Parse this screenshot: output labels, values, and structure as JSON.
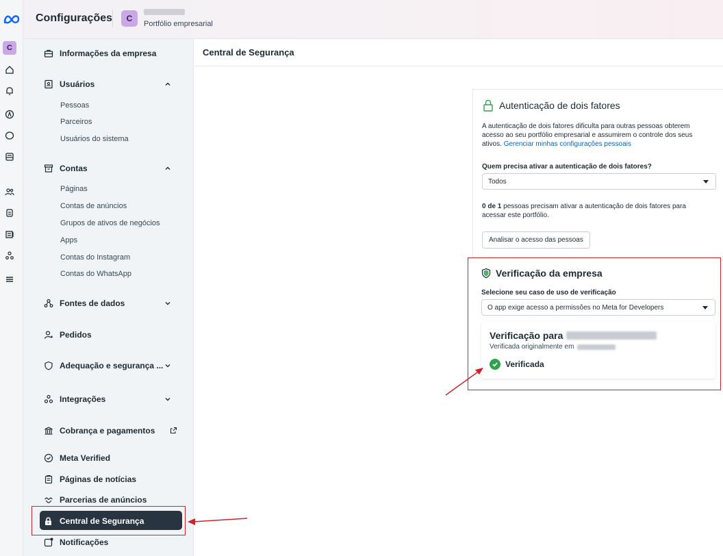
{
  "header": {
    "title": "Configurações",
    "business_avatar": "C",
    "business_subtitle": "Portfólio empresarial"
  },
  "rail": {
    "avatar": "C",
    "icons": [
      "meta-logo-icon",
      "home-icon",
      "bell-icon",
      "ads-icon",
      "chat-icon",
      "inbox-icon",
      "people-icon",
      "assets-icon",
      "tools-icon",
      "data-icon",
      "menu-icon"
    ]
  },
  "sidebar": {
    "company_info": "Informações da empresa",
    "users": {
      "label": "Usuários",
      "items": [
        "Pessoas",
        "Parceiros",
        "Usuários do sistema"
      ]
    },
    "accounts": {
      "label": "Contas",
      "items": [
        "Páginas",
        "Contas de anúncios",
        "Grupos de ativos de negócios",
        "Apps",
        "Contas do Instagram",
        "Contas do WhatsApp"
      ]
    },
    "data_sources": "Fontes de dados",
    "requests": "Pedidos",
    "compliance": "Adequação e segurança ...",
    "integrations": "Integrações",
    "billing": "Cobrança e pagamentos",
    "meta_verified": "Meta Verified",
    "news_pages": "Páginas de notícias",
    "ad_partnerships": "Parcerias de anúncios",
    "security_center": "Central de Segurança",
    "notifications": "Notificações"
  },
  "main": {
    "title": "Central de Segurança"
  },
  "two_factor": {
    "title": "Autenticação de dois fatores",
    "description": "A autenticação de dois fatores dificulta para outras pessoas obterem acesso ao seu portfólio empresarial e assumirem o controle dos seus ativos.",
    "link": "Gerenciar minhas configurações pessoais",
    "question": "Quem precisa ativar a autenticação de dois fatores?",
    "selected": "Todos",
    "count_bold": "0 de 1",
    "count_rest": " pessoas precisam ativar a autenticação de dois fatores para acessar este portfólio.",
    "review_button": "Analisar o acesso das pessoas"
  },
  "business_verification": {
    "title": "Verificação da empresa",
    "question": "Selecione seu caso de uso de verificação",
    "selected": "O app exige acesso a permissões no Meta for Developers",
    "verification_for": "Verificação para",
    "verified_originally": "Verificada originalmente em",
    "status": "Verificada",
    "status_color": "#31a24c"
  },
  "colors": {
    "accent": "#0a66c2",
    "highlight": "#d0222a",
    "active_item_bg": "#283540"
  }
}
